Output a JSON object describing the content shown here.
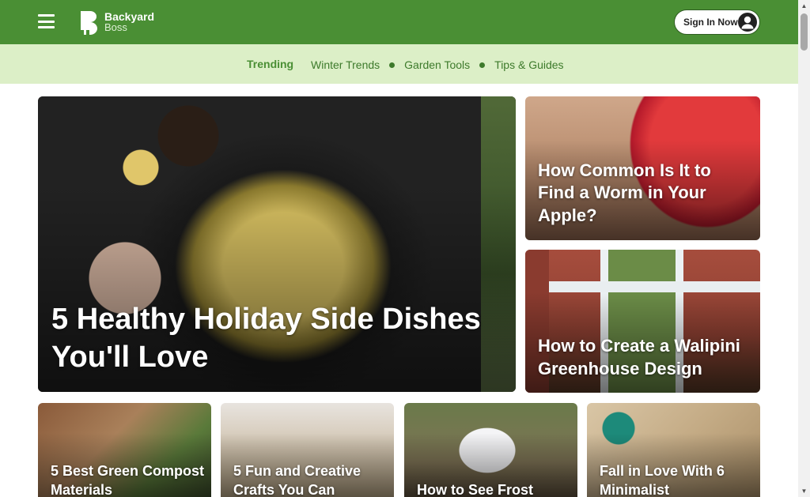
{
  "header": {
    "logo_line1": "Backyard",
    "logo_line2": "Boss",
    "signin_label": "Sign In Now",
    "bar_color": "#4a8f34"
  },
  "trending": {
    "title": "Trending",
    "links": [
      "Winter Trends",
      "Garden Tools",
      "Tips & Guides"
    ],
    "bar_color": "#dcefc7"
  },
  "featured": {
    "title": "5 Healthy Holiday Side Dishes You'll Love"
  },
  "side_cards": [
    {
      "title": "How Common Is It to Find a Worm in Your Apple?"
    },
    {
      "title": "How to Create a Walipini Greenhouse Design"
    }
  ],
  "small_cards": [
    {
      "title": "5 Best Green Compost Materials"
    },
    {
      "title": "5 Fun and Creative Crafts You Can"
    },
    {
      "title": "How to See Frost"
    },
    {
      "title": "Fall in Love With 6 Minimalist"
    }
  ],
  "icons": {
    "menu": "hamburger-menu-icon",
    "account": "user-avatar-icon",
    "scroll_up": "arrow-up-icon",
    "scroll_down": "arrow-down-icon"
  }
}
